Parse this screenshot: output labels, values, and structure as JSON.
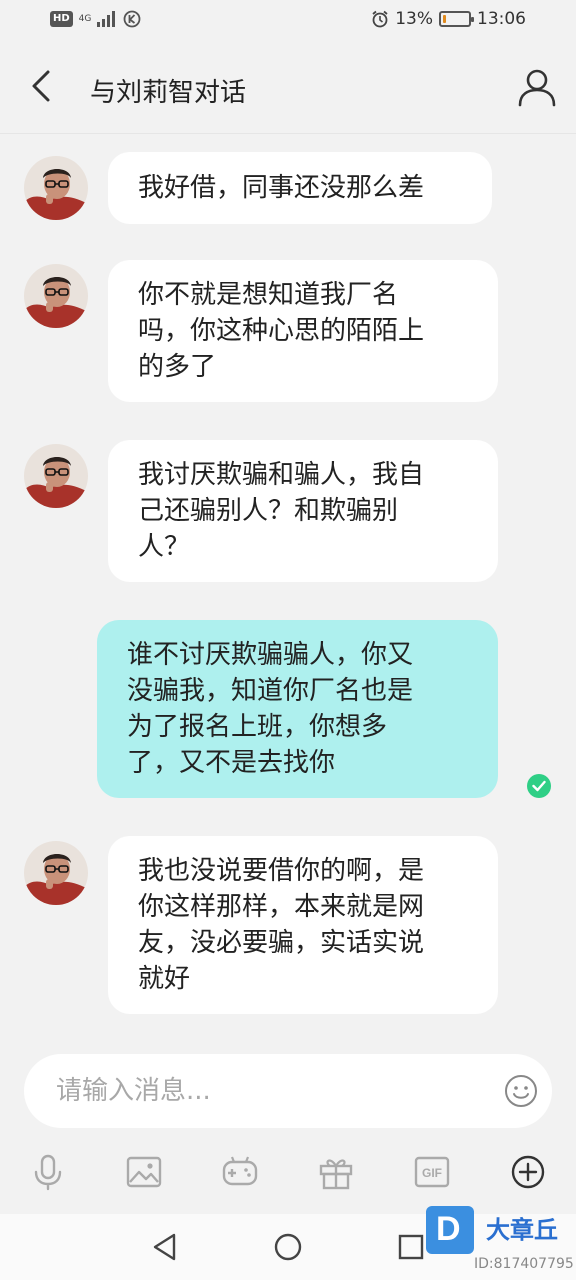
{
  "status_bar": {
    "network": "4G",
    "battery": "13%",
    "battery_level": 0.13,
    "time": "13:06",
    "icons": [
      "hd-icon",
      "signal-icon",
      "k-icon",
      "alarm-icon",
      "battery-icon"
    ]
  },
  "header": {
    "title": "与刘莉智对话",
    "icons": [
      "back-arrow-icon",
      "user-profile-icon"
    ]
  },
  "messages": [
    {
      "side": "incoming",
      "text": "我好借，同事还没那么差"
    },
    {
      "side": "incoming",
      "text": "你不就是想知道我厂名\n吗，你这种心思的陌陌上\n的多了"
    },
    {
      "side": "incoming",
      "text": "我讨厌欺骗和骗人，我自\n己还骗别人？和欺骗别\n人？"
    },
    {
      "side": "outgoing",
      "text": "谁不讨厌欺骗骗人，你又\n没骗我，知道你厂名也是\n为了报名上班，你想多\n了，又不是去找你",
      "status": "read"
    },
    {
      "side": "incoming",
      "text": "我也没说要借你的啊，是\n你这样那样，本来就是网\n友，没必要骗，实话实说\n就好"
    }
  ],
  "input": {
    "placeholder": "请输入消息..."
  },
  "toolbar": {
    "icons": [
      "microphone-icon",
      "image-icon",
      "game-controller-icon",
      "gift-icon",
      "gif-icon",
      "plus-circle-icon"
    ]
  },
  "nav": {
    "icons": [
      "nav-back-icon",
      "nav-home-icon",
      "nav-recents-icon"
    ]
  },
  "watermark": {
    "logo_letter": "D",
    "name": "大章丘",
    "id": "ID:817407795"
  },
  "colors": {
    "background": "#f2f2f2",
    "incoming_bubble": "#ffffff",
    "outgoing_bubble": "#aef0ee",
    "read_check": "#2fcf86",
    "battery": "#e08a1e"
  }
}
